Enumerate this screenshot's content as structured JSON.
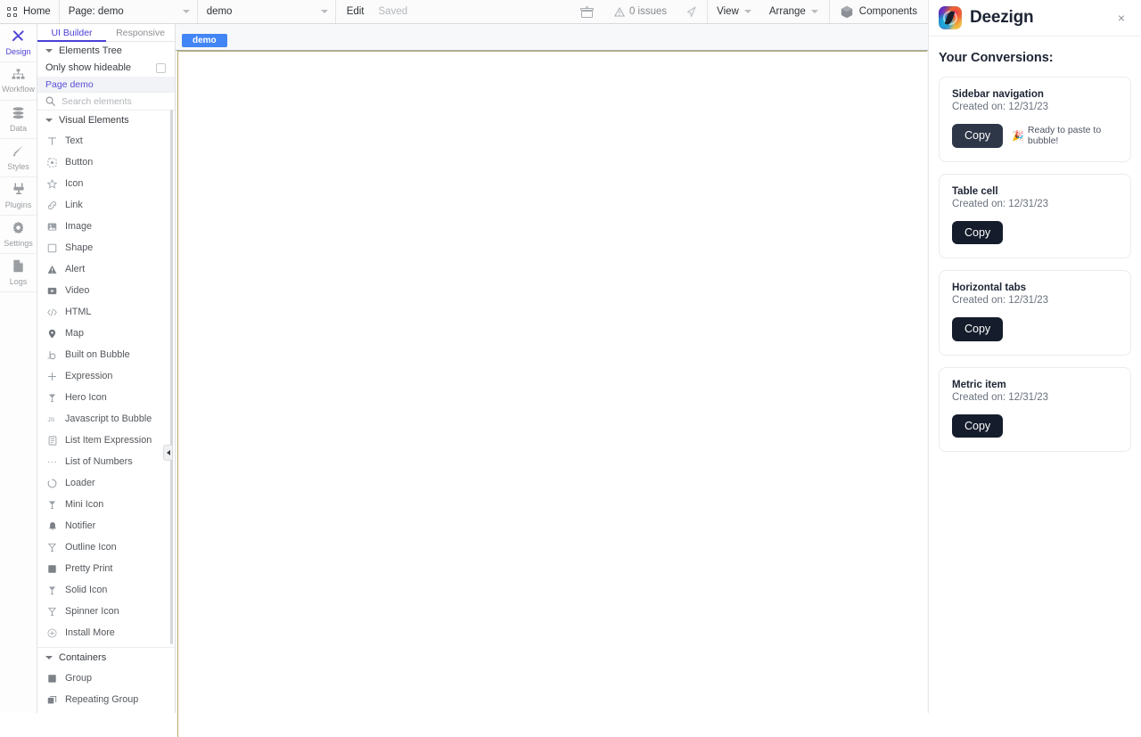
{
  "topbar": {
    "home_label": "Home",
    "page_select": "Page: demo",
    "element_select": "demo",
    "edit_label": "Edit",
    "saved_label": "Saved",
    "issues_label": "0 issues",
    "view_label": "View",
    "arrange_label": "Arrange",
    "components_label": "Components"
  },
  "rail": {
    "items": [
      {
        "label": "Design",
        "icon": "design-icon",
        "active": true
      },
      {
        "label": "Workflow",
        "icon": "workflow-icon",
        "active": false
      },
      {
        "label": "Data",
        "icon": "data-icon",
        "active": false
      },
      {
        "label": "Styles",
        "icon": "styles-icon",
        "active": false
      },
      {
        "label": "Plugins",
        "icon": "plugins-icon",
        "active": false
      },
      {
        "label": "Settings",
        "icon": "settings-icon",
        "active": false
      },
      {
        "label": "Logs",
        "icon": "logs-icon",
        "active": false
      }
    ]
  },
  "left_panel": {
    "tabs": [
      {
        "label": "UI Builder",
        "active": true
      },
      {
        "label": "Responsive",
        "active": false
      }
    ],
    "elements_tree_label": "Elements Tree",
    "only_show_hideable_label": "Only show hideable",
    "page_node_label": "Page demo",
    "search_placeholder": "Search elements",
    "search_value": "",
    "visual_elements_label": "Visual Elements",
    "visual_elements": [
      {
        "label": "Text",
        "icon": "text-icon"
      },
      {
        "label": "Button",
        "icon": "button-icon"
      },
      {
        "label": "Icon",
        "icon": "star-icon"
      },
      {
        "label": "Link",
        "icon": "link-icon"
      },
      {
        "label": "Image",
        "icon": "image-icon"
      },
      {
        "label": "Shape",
        "icon": "shape-icon"
      },
      {
        "label": "Alert",
        "icon": "alert-icon"
      },
      {
        "label": "Video",
        "icon": "video-icon"
      },
      {
        "label": "HTML",
        "icon": "code-icon"
      },
      {
        "label": "Map",
        "icon": "map-pin-icon"
      },
      {
        "label": "Built on Bubble",
        "icon": "bubble-icon"
      },
      {
        "label": "Expression",
        "icon": "plus-icon"
      },
      {
        "label": "Hero Icon",
        "icon": "hero-icon"
      },
      {
        "label": "Javascript to Bubble",
        "icon": "js-icon"
      },
      {
        "label": "List Item Expression",
        "icon": "list-item-icon"
      },
      {
        "label": "List of Numbers",
        "icon": "ellipsis-icon"
      },
      {
        "label": "Loader",
        "icon": "loader-icon"
      },
      {
        "label": "Mini Icon",
        "icon": "mini-icon"
      },
      {
        "label": "Notifier",
        "icon": "bell-icon"
      },
      {
        "label": "Outline Icon",
        "icon": "outline-icon"
      },
      {
        "label": "Pretty Print",
        "icon": "pretty-print-icon"
      },
      {
        "label": "Solid Icon",
        "icon": "solid-icon"
      },
      {
        "label": "Spinner Icon",
        "icon": "spinner-icon"
      },
      {
        "label": "Install More",
        "icon": "install-more-icon"
      }
    ],
    "containers_label": "Containers",
    "containers": [
      {
        "label": "Group",
        "icon": "group-icon"
      },
      {
        "label": "Repeating Group",
        "icon": "repeating-group-icon"
      }
    ]
  },
  "canvas": {
    "tag_label": "demo"
  },
  "deezign": {
    "title": "Deezign",
    "close_label": "×",
    "heading": "Your Conversions:",
    "conversions": [
      {
        "title": "Sidebar navigation",
        "created": "Created on: 12/31/23",
        "copy_label": "Copy",
        "status": "Ready to paste to bubble!",
        "status_emoji": "🎉",
        "has_status": true
      },
      {
        "title": "Table cell",
        "created": "Created on: 12/31/23",
        "copy_label": "Copy",
        "has_status": false
      },
      {
        "title": "Horizontal tabs",
        "created": "Created on: 12/31/23",
        "copy_label": "Copy",
        "has_status": false
      },
      {
        "title": "Metric item",
        "created": "Created on: 12/31/23",
        "copy_label": "Copy",
        "has_status": false
      }
    ]
  },
  "colors": {
    "accent_purple": "#4b3fd6",
    "tag_blue": "#4285f4",
    "button_dark": "#151c2c",
    "button_dark_soft": "#2e3748",
    "canvas_border": "#bda873"
  }
}
